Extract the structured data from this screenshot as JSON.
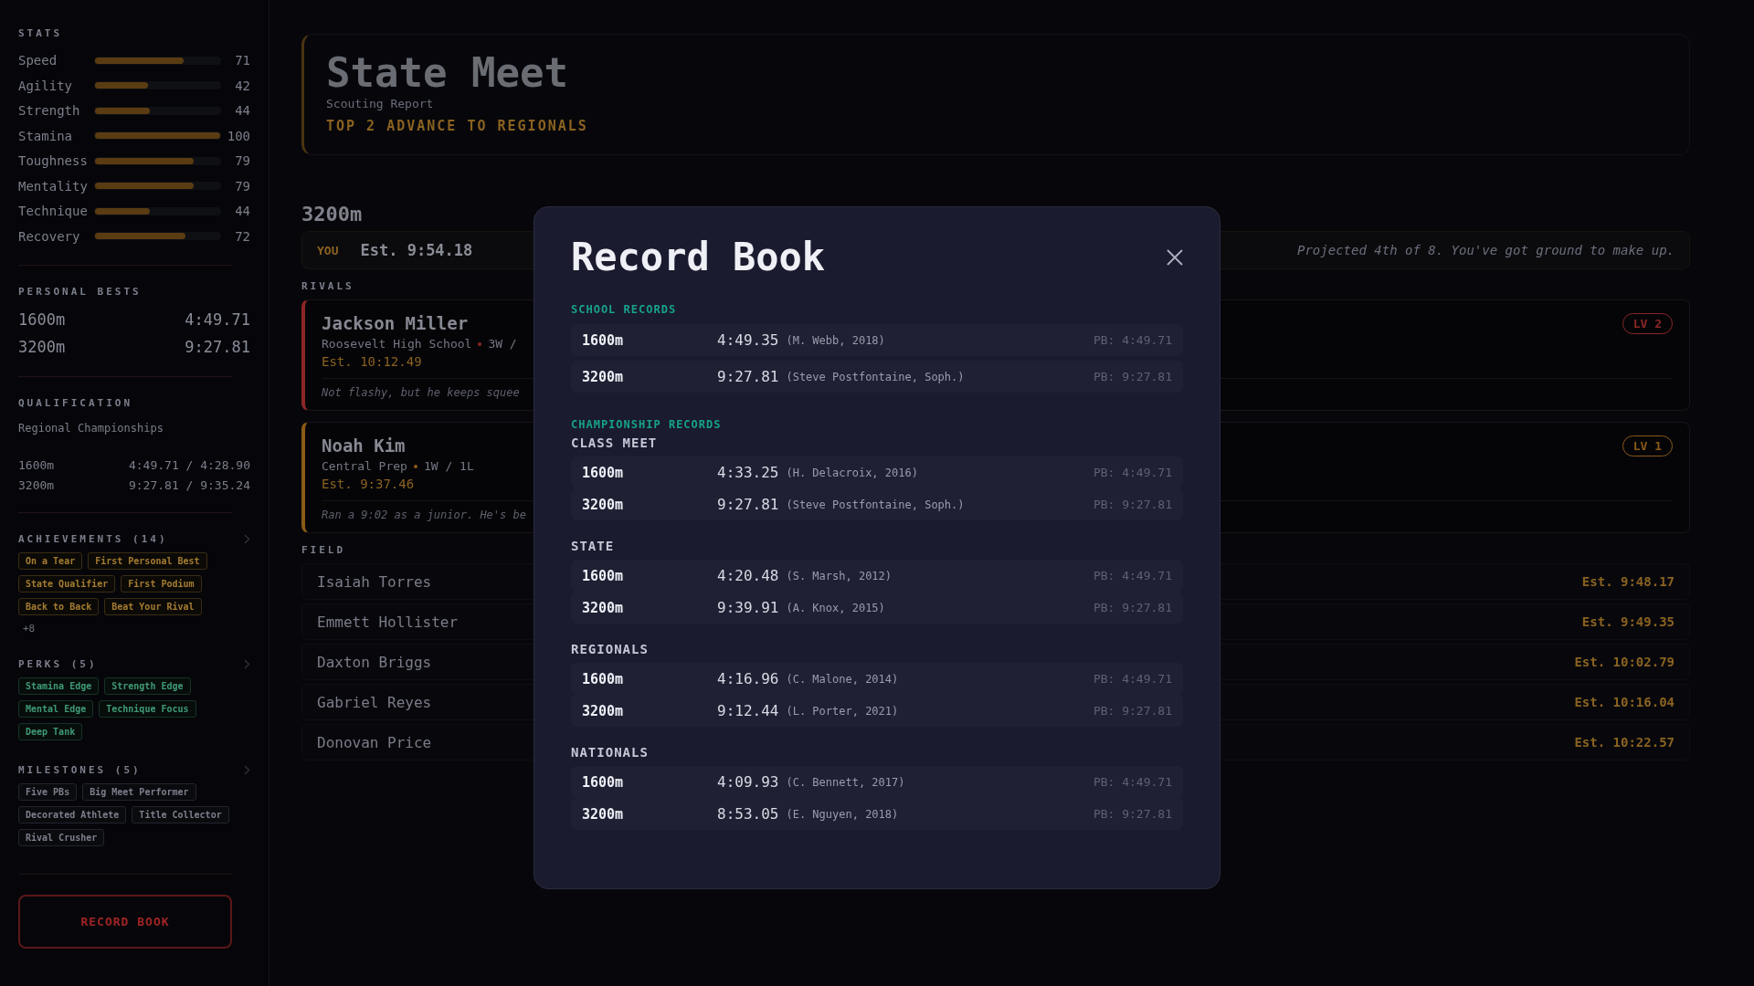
{
  "sidebar": {
    "stats_title": "STATS",
    "stats": [
      {
        "name": "Speed",
        "value": "71",
        "level": 0.71
      },
      {
        "name": "Agility",
        "value": "42",
        "level": 0.42
      },
      {
        "name": "Strength",
        "value": "44",
        "level": 0.44
      },
      {
        "name": "Stamina",
        "value": "100",
        "level": 1.0
      },
      {
        "name": "Toughness",
        "value": "79",
        "level": 0.79
      },
      {
        "name": "Mentality",
        "value": "79",
        "level": 0.79
      },
      {
        "name": "Technique",
        "value": "44",
        "level": 0.44
      },
      {
        "name": "Recovery",
        "value": "72",
        "level": 0.72
      }
    ],
    "personal_bests": {
      "title": "PERSONAL BESTS",
      "items": [
        {
          "event": "1600m",
          "time": "4:49.71"
        },
        {
          "event": "3200m",
          "time": "9:27.81"
        }
      ]
    },
    "qualification": {
      "title": "QUALIFICATION",
      "meet": "Regional Championships",
      "items": [
        {
          "event": "1600m",
          "times": "4:49.71 / 4:28.90"
        },
        {
          "event": "3200m",
          "times": "9:27.81 / 9:35.24"
        }
      ]
    },
    "tag_groups": [
      {
        "title": "ACHIEVEMENTS (14)",
        "kind": "achievement",
        "tags": [
          "On a Tear",
          "First Personal Best",
          "State Qualifier",
          "First Podium",
          "Back to Back",
          "Beat Your Rival"
        ],
        "more": "+8"
      },
      {
        "title": "PERKS (5)",
        "kind": "perk",
        "tags": [
          "Stamina Edge",
          "Strength Edge",
          "Mental Edge",
          "Technique Focus",
          "Deep Tank"
        ]
      },
      {
        "title": "MILESTONES (5)",
        "kind": "milestone",
        "tags": [
          "Five PBs",
          "Big Meet Performer",
          "Decorated Athlete",
          "Title Collector",
          "Rival Crusher"
        ]
      }
    ],
    "record_book_button": "RECORD BOOK"
  },
  "header": {
    "title": "State Meet",
    "subtitle": "Scouting Report",
    "note": "TOP 2 ADVANCE TO REGIONALS"
  },
  "event": {
    "name": "3200m",
    "you_label": "YOU",
    "estimate": "Est. 9:54.18",
    "projection": "Projected 4th of 8. You've got ground to make up."
  },
  "rivals": {
    "title": "RIVALS",
    "items": [
      {
        "name": "Jackson Miller",
        "school": "Roosevelt High School",
        "record": "3W /",
        "estimate": "Est. 10:12.49",
        "note": "Not flashy, but he keeps squee",
        "badge": "LV 2",
        "color": "#8c2626"
      },
      {
        "name": "Noah Kim",
        "school": "Central Prep",
        "record": "1W / 1L",
        "estimate": "Est. 9:37.46",
        "note": "Ran a 9:02 as a junior. He's be",
        "badge": "LV 1",
        "color": "#8a5a16"
      }
    ]
  },
  "field": {
    "title": "FIELD",
    "items": [
      {
        "name": "Isaiah Torres",
        "estimate": "Est. 9:48.17"
      },
      {
        "name": "Emmett Hollister",
        "estimate": "Est. 9:49.35"
      },
      {
        "name": "Daxton Briggs",
        "estimate": "Est. 10:02.79"
      },
      {
        "name": "Gabriel Reyes",
        "estimate": "Est. 10:16.04"
      },
      {
        "name": "Donovan Price",
        "estimate": "Est. 10:22.57"
      }
    ]
  },
  "modal": {
    "title": "Record Book",
    "sections": [
      {
        "title": "SCHOOL RECORDS",
        "groups": [
          {
            "rows": [
              {
                "event": "1600m",
                "time": "4:49.35",
                "holder": "(M. Webb, 2018)",
                "pb": "PB: 4:49.71"
              },
              {
                "event": "3200m",
                "time": "9:27.81",
                "holder": "(Steve Postfontaine, Soph.)",
                "pb": "PB: 9:27.81"
              }
            ]
          }
        ]
      },
      {
        "title": "CHAMPIONSHIP RECORDS",
        "groups": [
          {
            "title": "CLASS MEET",
            "rows": [
              {
                "event": "1600m",
                "time": "4:33.25",
                "holder": "(H. Delacroix, 2016)",
                "pb": "PB: 4:49.71"
              },
              {
                "event": "3200m",
                "time": "9:27.81",
                "holder": "(Steve Postfontaine, Soph.)",
                "pb": "PB: 9:27.81"
              }
            ]
          },
          {
            "title": "STATE",
            "rows": [
              {
                "event": "1600m",
                "time": "4:20.48",
                "holder": "(S. Marsh, 2012)",
                "pb": "PB: 4:49.71"
              },
              {
                "event": "3200m",
                "time": "9:39.91",
                "holder": "(A. Knox, 2015)",
                "pb": "PB: 9:27.81"
              }
            ]
          },
          {
            "title": "REGIONALS",
            "rows": [
              {
                "event": "1600m",
                "time": "4:16.96",
                "holder": "(C. Malone, 2014)",
                "pb": "PB: 4:49.71"
              },
              {
                "event": "3200m",
                "time": "9:12.44",
                "holder": "(L. Porter, 2021)",
                "pb": "PB: 9:27.81"
              }
            ]
          },
          {
            "title": "NATIONALS",
            "rows": [
              {
                "event": "1600m",
                "time": "4:09.93",
                "holder": "(C. Bennett, 2017)",
                "pb": "PB: 4:49.71"
              },
              {
                "event": "3200m",
                "time": "8:53.05",
                "holder": "(E. Nguyen, 2018)",
                "pb": "PB: 9:27.81"
              }
            ]
          }
        ]
      }
    ]
  }
}
